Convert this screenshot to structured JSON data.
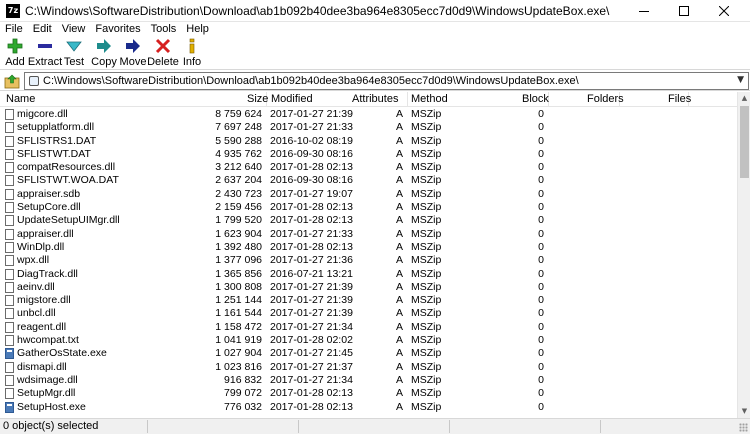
{
  "window": {
    "app_icon_text": "7z",
    "title": "C:\\Windows\\SoftwareDistribution\\Download\\ab1b092b40dee3ba964e8305ecc7d0d9\\WindowsUpdateBox.exe\\",
    "minimize_icon": "minimize-icon",
    "maximize_icon": "maximize-icon",
    "close_icon": "close-icon"
  },
  "menu": [
    "File",
    "Edit",
    "View",
    "Favorites",
    "Tools",
    "Help"
  ],
  "toolbar": {
    "add": "Add",
    "extract": "Extract",
    "test": "Test",
    "copy": "Copy",
    "move": "Move",
    "delete": "Delete",
    "info": "Info"
  },
  "colors": {
    "add_icon": "#2fa82f",
    "extract_icon": "#2b2b9e",
    "test_icon": "#38b8c8",
    "copy_icon": "#1e8c8c",
    "move_icon": "#1a2b8c",
    "delete_icon": "#d62020",
    "info_icon": "#e0b000"
  },
  "address": {
    "up_icon": "folder-up-icon",
    "path": "C:\\Windows\\SoftwareDistribution\\Download\\ab1b092b40dee3ba964e8305ecc7d0d9\\WindowsUpdateBox.exe\\"
  },
  "columns": {
    "name": "Name",
    "size": "Size",
    "modified": "Modified",
    "attributes": "Attributes",
    "method": "Method",
    "block": "Block",
    "folders": "Folders",
    "files": "Files"
  },
  "files": [
    {
      "name": "migcore.dll",
      "size": "8 759 624",
      "modified": "2017-01-27 21:39",
      "attr": "A",
      "method": "MSZip",
      "block": "0",
      "icon": "file"
    },
    {
      "name": "setupplatform.dll",
      "size": "7 697 248",
      "modified": "2017-01-27 21:33",
      "attr": "A",
      "method": "MSZip",
      "block": "0",
      "icon": "file"
    },
    {
      "name": "SFLISTRS1.DAT",
      "size": "5 590 288",
      "modified": "2016-10-02 08:19",
      "attr": "A",
      "method": "MSZip",
      "block": "0",
      "icon": "file"
    },
    {
      "name": "SFLISTWT.DAT",
      "size": "4 935 762",
      "modified": "2016-09-30 08:16",
      "attr": "A",
      "method": "MSZip",
      "block": "0",
      "icon": "file"
    },
    {
      "name": "compatResources.dll",
      "size": "3 212 640",
      "modified": "2017-01-28 02:13",
      "attr": "A",
      "method": "MSZip",
      "block": "0",
      "icon": "file"
    },
    {
      "name": "SFLISTWT.WOA.DAT",
      "size": "2 637 204",
      "modified": "2016-09-30 08:16",
      "attr": "A",
      "method": "MSZip",
      "block": "0",
      "icon": "file"
    },
    {
      "name": "appraiser.sdb",
      "size": "2 430 723",
      "modified": "2017-01-27 19:07",
      "attr": "A",
      "method": "MSZip",
      "block": "0",
      "icon": "file"
    },
    {
      "name": "SetupCore.dll",
      "size": "2 159 456",
      "modified": "2017-01-28 02:13",
      "attr": "A",
      "method": "MSZip",
      "block": "0",
      "icon": "file"
    },
    {
      "name": "UpdateSetupUIMgr.dll",
      "size": "1 799 520",
      "modified": "2017-01-28 02:13",
      "attr": "A",
      "method": "MSZip",
      "block": "0",
      "icon": "file"
    },
    {
      "name": "appraiser.dll",
      "size": "1 623 904",
      "modified": "2017-01-27 21:33",
      "attr": "A",
      "method": "MSZip",
      "block": "0",
      "icon": "file"
    },
    {
      "name": "WinDlp.dll",
      "size": "1 392 480",
      "modified": "2017-01-28 02:13",
      "attr": "A",
      "method": "MSZip",
      "block": "0",
      "icon": "file"
    },
    {
      "name": "wpx.dll",
      "size": "1 377 096",
      "modified": "2017-01-27 21:36",
      "attr": "A",
      "method": "MSZip",
      "block": "0",
      "icon": "file"
    },
    {
      "name": "DiagTrack.dll",
      "size": "1 365 856",
      "modified": "2016-07-21 13:21",
      "attr": "A",
      "method": "MSZip",
      "block": "0",
      "icon": "file"
    },
    {
      "name": "aeinv.dll",
      "size": "1 300 808",
      "modified": "2017-01-27 21:39",
      "attr": "A",
      "method": "MSZip",
      "block": "0",
      "icon": "file"
    },
    {
      "name": "migstore.dll",
      "size": "1 251 144",
      "modified": "2017-01-27 21:39",
      "attr": "A",
      "method": "MSZip",
      "block": "0",
      "icon": "file"
    },
    {
      "name": "unbcl.dll",
      "size": "1 161 544",
      "modified": "2017-01-27 21:39",
      "attr": "A",
      "method": "MSZip",
      "block": "0",
      "icon": "file"
    },
    {
      "name": "reagent.dll",
      "size": "1 158 472",
      "modified": "2017-01-27 21:34",
      "attr": "A",
      "method": "MSZip",
      "block": "0",
      "icon": "file"
    },
    {
      "name": "hwcompat.txt",
      "size": "1 041 919",
      "modified": "2017-01-28 02:02",
      "attr": "A",
      "method": "MSZip",
      "block": "0",
      "icon": "file"
    },
    {
      "name": "GatherOsState.exe",
      "size": "1 027 904",
      "modified": "2017-01-27 21:45",
      "attr": "A",
      "method": "MSZip",
      "block": "0",
      "icon": "exe"
    },
    {
      "name": "dismapi.dll",
      "size": "1 023 816",
      "modified": "2017-01-27 21:37",
      "attr": "A",
      "method": "MSZip",
      "block": "0",
      "icon": "file"
    },
    {
      "name": "wdsimage.dll",
      "size": "916 832",
      "modified": "2017-01-27 21:34",
      "attr": "A",
      "method": "MSZip",
      "block": "0",
      "icon": "file"
    },
    {
      "name": "SetupMgr.dll",
      "size": "799 072",
      "modified": "2017-01-28 02:13",
      "attr": "A",
      "method": "MSZip",
      "block": "0",
      "icon": "file"
    },
    {
      "name": "SetupHost.exe",
      "size": "776 032",
      "modified": "2017-01-28 02:13",
      "attr": "A",
      "method": "MSZip",
      "block": "0",
      "icon": "exe"
    }
  ],
  "status": {
    "text": "0 object(s) selected"
  }
}
